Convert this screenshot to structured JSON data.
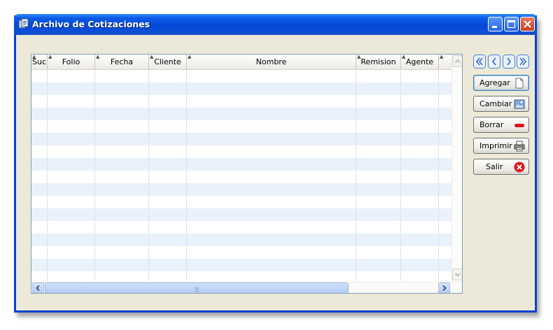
{
  "window": {
    "title": "Archivo de Cotizaciones",
    "title_bar_color": "#0a56e0"
  },
  "grid": {
    "columns": [
      {
        "label": "Suc"
      },
      {
        "label": "Folio"
      },
      {
        "label": "Fecha"
      },
      {
        "label": "Cliente"
      },
      {
        "label": "Nombre"
      },
      {
        "label": "Remision"
      },
      {
        "label": "Agente"
      }
    ],
    "rows": [],
    "row_stripe_color": "#e9f1fb"
  },
  "navigation": {
    "icons": [
      "first-record-icon",
      "previous-record-icon",
      "next-record-icon",
      "last-record-icon"
    ]
  },
  "actions": {
    "add_label": "Agregar",
    "change_label": "Cambiar",
    "delete_label": "Borrar",
    "print_label": "Imprimir",
    "exit_label": "Salir"
  }
}
